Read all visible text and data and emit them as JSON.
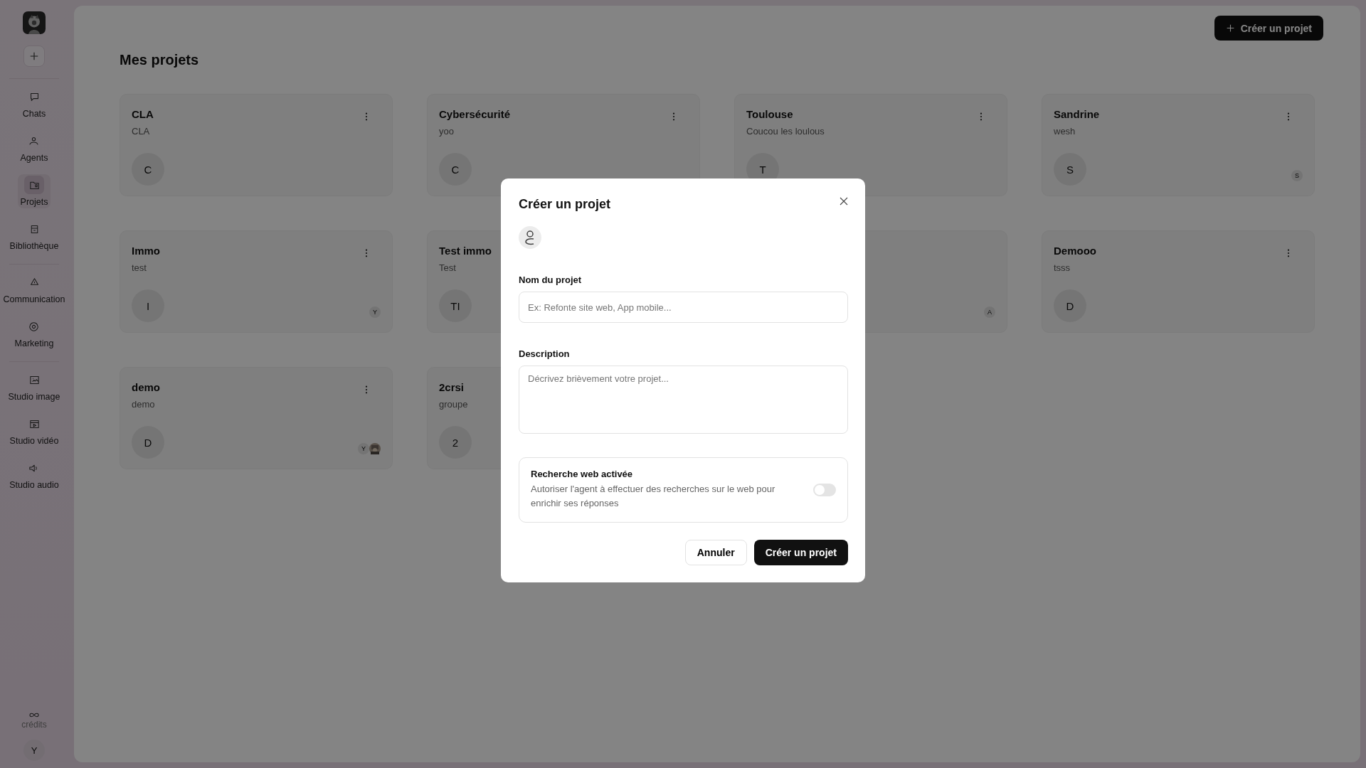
{
  "sidebar": {
    "groups": [
      {
        "items": [
          {
            "label": "Chats",
            "selected": false
          },
          {
            "label": "Agents",
            "selected": false
          },
          {
            "label": "Projets",
            "selected": true
          },
          {
            "label": "Bibliothèque",
            "selected": false
          }
        ]
      },
      {
        "items": [
          {
            "label": "Communication",
            "selected": false
          },
          {
            "label": "Marketing",
            "selected": false
          }
        ]
      },
      {
        "items": [
          {
            "label": "Studio image",
            "selected": false
          },
          {
            "label": "Studio vidéo",
            "selected": false
          },
          {
            "label": "Studio audio",
            "selected": false
          }
        ]
      }
    ],
    "credits": "crédits",
    "user_initial": "Y"
  },
  "header": {
    "create_button": "Créer un projet"
  },
  "title": "Mes projets",
  "projects": [
    {
      "title": "CLA",
      "description": "CLA",
      "initial": "C"
    },
    {
      "title": "Cybersécurité",
      "description": "yoo",
      "initial": "C"
    },
    {
      "title": "Toulouse",
      "description": "Coucou les loulous",
      "initial": "T"
    },
    {
      "title": "Sandrine",
      "description": "wesh",
      "initial": "S",
      "members": [
        {
          "kind": "letter",
          "label": "S"
        }
      ]
    },
    {
      "title": "Immo",
      "description": "test",
      "initial": "I",
      "members": [
        {
          "kind": "letter",
          "label": "Y"
        }
      ]
    },
    {
      "title": "Test immo",
      "description": "Test",
      "initial": "TI"
    },
    {
      "members": [
        {
          "kind": "letter",
          "label": "A"
        }
      ]
    },
    {
      "title": "Demooo",
      "description": "tsss",
      "initial": "D"
    },
    {
      "title": "demo",
      "description": "demo",
      "initial": "D",
      "members": [
        {
          "kind": "letter",
          "label": "Y"
        },
        {
          "kind": "picture"
        }
      ]
    },
    {
      "title": "2crsi",
      "description": "groupe",
      "initial": "2"
    }
  ],
  "modal": {
    "title": "Créer un projet",
    "name_field": {
      "label": "Nom du projet",
      "placeholder": "Ex: Refonte site web, App mobile..."
    },
    "description_field": {
      "label": "Description",
      "placeholder": "Décrivez brièvement votre projet..."
    },
    "web_search": {
      "title": "Recherche web activée",
      "description": "Autoriser l'agent à effectuer des recherches sur le web pour enrichir ses réponses",
      "on": false
    },
    "cancel_button": "Annuler",
    "submit_button": "Créer un projet"
  }
}
